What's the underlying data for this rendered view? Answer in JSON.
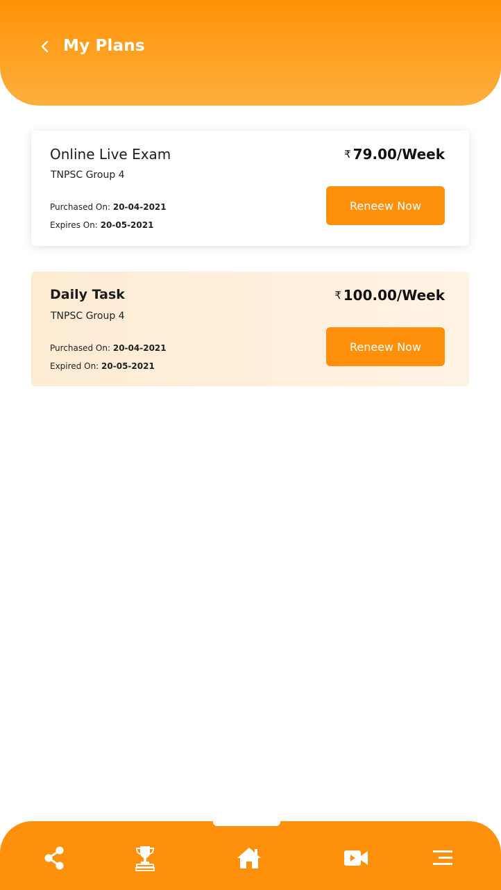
{
  "header": {
    "title": "My Plans",
    "back_icon": "chevron-left-icon"
  },
  "plans": [
    {
      "name": "Online Live Exam",
      "group": "TNPSC Group 4",
      "currency": "₹",
      "price": "79.00/Week",
      "purchased_label": "Purchased On:",
      "purchased_date": "20-04-2021",
      "expiry_label": "Expires On:",
      "expiry_date": "20-05-2021",
      "button_label": "Reneew Now"
    },
    {
      "name": "Daily Task",
      "group": "TNPSC Group 4",
      "currency": "₹",
      "price": "100.00/Week",
      "purchased_label": "Purchased On:",
      "purchased_date": "20-04-2021",
      "expiry_label": "Expired On:",
      "expiry_date": "20-05-2021",
      "button_label": "Reneew Now"
    }
  ],
  "bottom_nav": {
    "items": [
      "share-icon",
      "trophy-icon",
      "home-icon",
      "video-icon",
      "menu-icon"
    ]
  },
  "colors": {
    "brand_orange": "#ff900b",
    "header_gradient_end": "#fcaf3e",
    "expired_card_bg": "#fdebd3"
  }
}
